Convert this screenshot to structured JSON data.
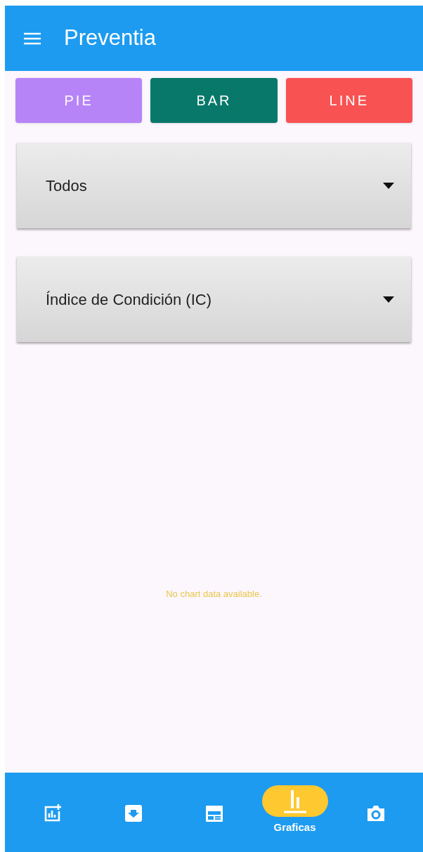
{
  "app_bar": {
    "title": "Preventia"
  },
  "chart_type_buttons": [
    {
      "label": "PIE",
      "color": "#b784f7"
    },
    {
      "label": "BAR",
      "color": "#08786a"
    },
    {
      "label": "LINE",
      "color": "#f85252"
    }
  ],
  "dropdowns": [
    {
      "value": "Todos"
    },
    {
      "value": "Índice de Condición (IC)"
    }
  ],
  "empty_message": "No chart data available.",
  "bottom_nav": [
    {
      "selected": false
    },
    {
      "selected": false
    },
    {
      "selected": false
    },
    {
      "label": "Graficas",
      "selected": true
    },
    {
      "selected": false
    }
  ]
}
